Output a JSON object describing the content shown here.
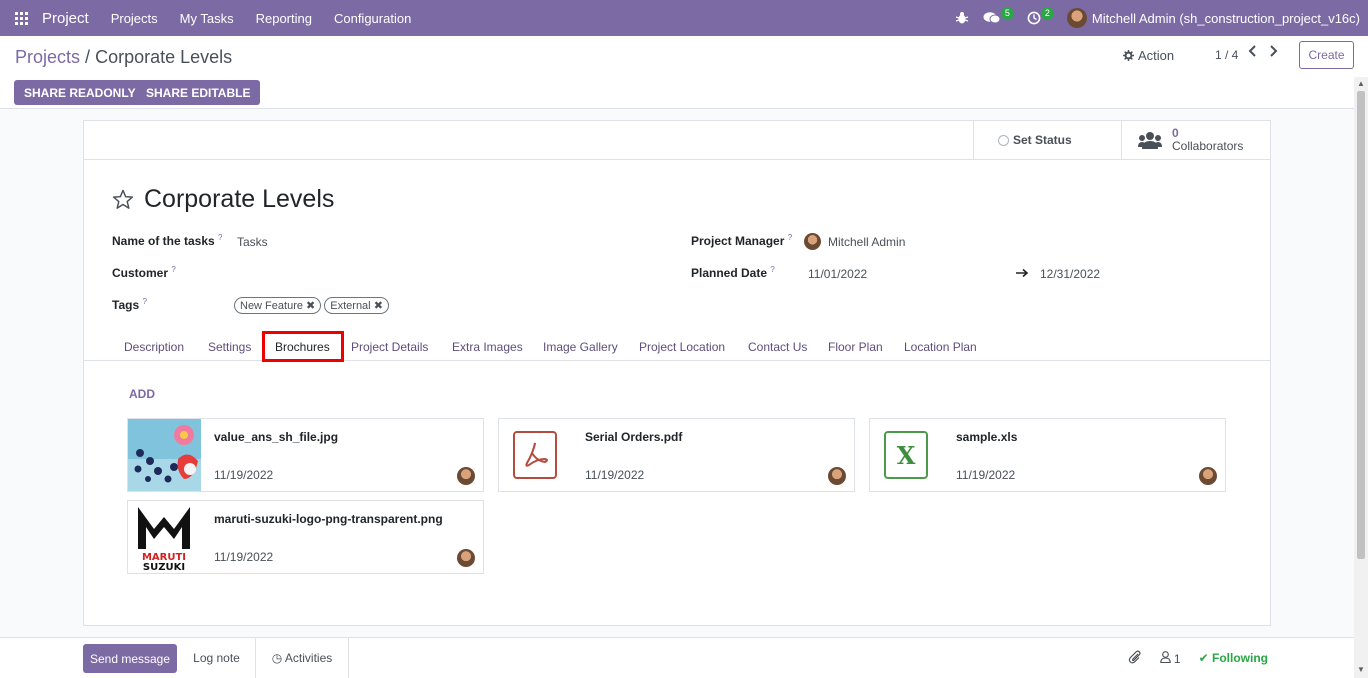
{
  "navbar": {
    "brand": "Project",
    "menu": [
      "Projects",
      "My Tasks",
      "Reporting",
      "Configuration"
    ],
    "messages_count": "5",
    "activities_count": "2",
    "user": "Mitchell Admin (sh_construction_project_v16c)",
    "color": "#7c6aa4"
  },
  "control": {
    "breadcrumb_root": "Projects",
    "breadcrumb_sep": "/",
    "breadcrumb_current": "Corporate Levels",
    "action_label": "Action",
    "pager": "1 / 4",
    "create_label": "Create",
    "share_readonly": "SHARE READONLY",
    "share_editable": "SHARE EDITABLE"
  },
  "sheet": {
    "set_status": "Set Status",
    "collaborators_count": "0",
    "collaborators_label": "Collaborators",
    "title": "Corporate Levels",
    "fields": {
      "tasks_label": "Name of the tasks",
      "tasks_value": "Tasks",
      "customer_label": "Customer",
      "tags_label": "Tags",
      "tags": [
        "New Feature",
        "External"
      ],
      "manager_label": "Project Manager",
      "manager_value": "Mitchell Admin",
      "planned_label": "Planned Date",
      "planned_start": "11/01/2022",
      "planned_end": "12/31/2022",
      "help_mark": "?"
    },
    "tabs": [
      "Description",
      "Settings",
      "Brochures",
      "Project Details",
      "Extra Images",
      "Image Gallery",
      "Project Location",
      "Contact Us",
      "Floor Plan",
      "Location Plan"
    ],
    "active_tab": "Brochures",
    "add_label": "ADD",
    "files": [
      {
        "name": "value_ans_sh_file.jpg",
        "date": "11/19/2022",
        "icon": "image-thumbnail"
      },
      {
        "name": "Serial Orders.pdf",
        "date": "11/19/2022",
        "icon": "pdf-icon"
      },
      {
        "name": "sample.xls",
        "date": "11/19/2022",
        "icon": "excel-icon"
      },
      {
        "name": "maruti-suzuki-logo-png-transparent.png",
        "date": "11/19/2022",
        "icon": "maruti-logo-thumbnail"
      }
    ],
    "logo_text_top": "MARUTI",
    "logo_text_bottom": "SUZUKI",
    "xls_letter": "X"
  },
  "chatter": {
    "send_message": "Send message",
    "log_note": "Log note",
    "activities": "Activities",
    "followers": "1",
    "following": "Following"
  }
}
